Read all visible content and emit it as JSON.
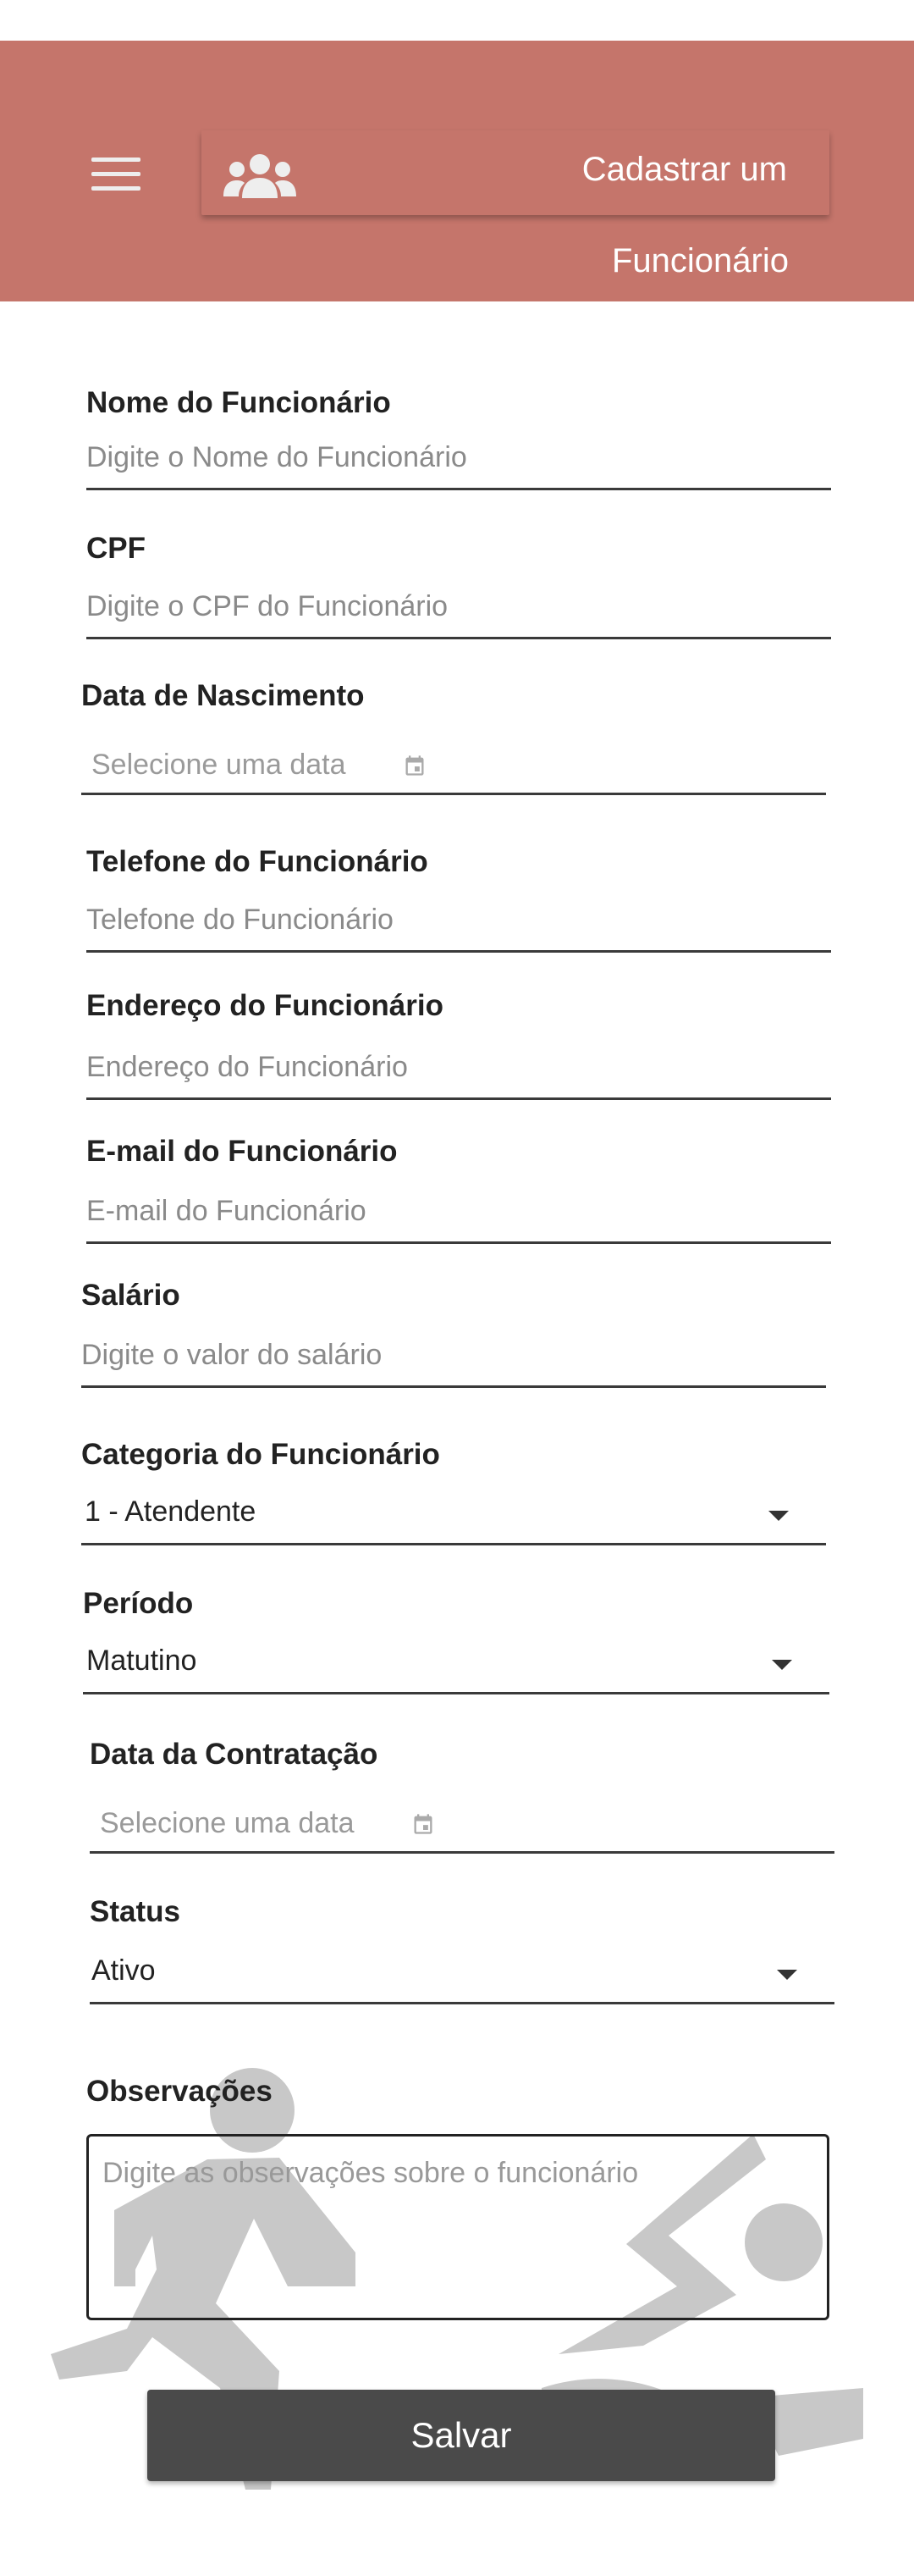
{
  "header": {
    "title_line1": "Cadastrar um",
    "title_line2": "Funcionário",
    "menu_icon": "menu-icon",
    "group_icon": "group-icon"
  },
  "form": {
    "nome": {
      "label": "Nome do Funcionário",
      "placeholder": "Digite o Nome do Funcionário"
    },
    "cpf": {
      "label": "CPF",
      "placeholder": "Digite o CPF do Funcionário"
    },
    "nascimento": {
      "label": "Data de Nascimento",
      "placeholder": "Selecione uma data"
    },
    "telefone": {
      "label": "Telefone do Funcionário",
      "placeholder": "Telefone do Funcionário"
    },
    "endereco": {
      "label": "Endereço do Funcionário",
      "placeholder": "Endereço do Funcionário"
    },
    "email": {
      "label": "E-mail do Funcionário",
      "placeholder": "E-mail do Funcionário"
    },
    "salario": {
      "label": "Salário",
      "placeholder": "Digite o valor do salário"
    },
    "categoria": {
      "label": "Categoria do Funcionário",
      "value": "1 - Atendente"
    },
    "periodo": {
      "label": "Período",
      "value": "Matutino"
    },
    "contratacao": {
      "label": "Data da Contratação",
      "placeholder": "Selecione uma data"
    },
    "status": {
      "label": "Status",
      "value": "Ativo"
    },
    "observacoes": {
      "label": "Observações",
      "placeholder": "Digite as observações sobre o funcionário"
    }
  },
  "actions": {
    "save_label": "Salvar"
  },
  "colors": {
    "header": "#c5756b",
    "button": "#4a4a4a",
    "decor": "#c8c8c8"
  }
}
